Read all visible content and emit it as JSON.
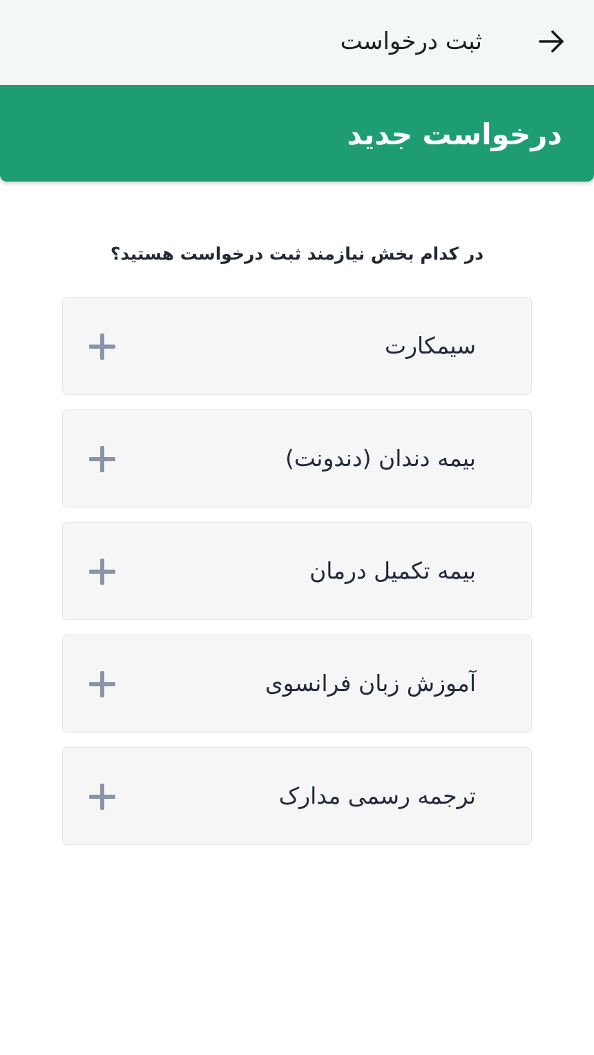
{
  "header": {
    "title": "ثبت درخواست",
    "back_icon": "arrow-right-icon"
  },
  "banner": {
    "title": "درخواست جدید",
    "color": "#1f9d72"
  },
  "question": "در کدام بخش نیازمند ثبت درخواست هستید؟",
  "options": [
    {
      "label": "سیمکارت",
      "icon": "plus-icon"
    },
    {
      "label": "بیمه دندان (دندونت)",
      "icon": "plus-icon"
    },
    {
      "label": "بیمه تکمیل درمان",
      "icon": "plus-icon"
    },
    {
      "label": "آموزش زبان فرانسوی",
      "icon": "plus-icon"
    },
    {
      "label": "ترجمه رسمی مدارک",
      "icon": "plus-icon"
    }
  ]
}
